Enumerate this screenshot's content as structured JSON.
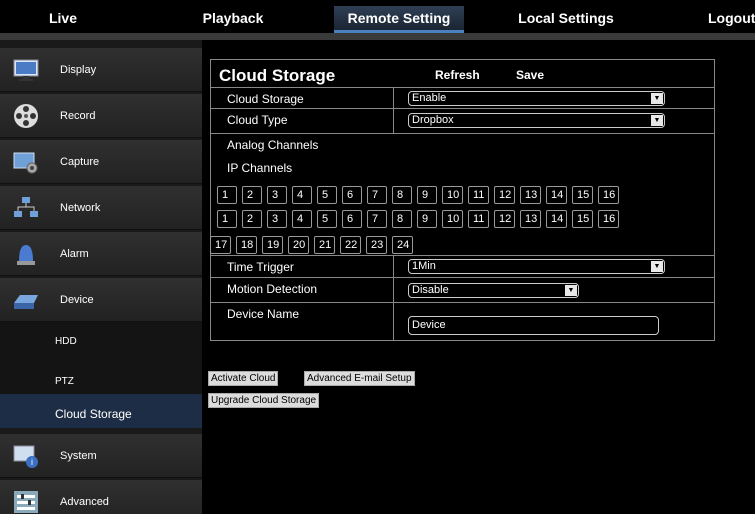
{
  "topnav": {
    "tabs": [
      {
        "label": "Live"
      },
      {
        "label": "Playback"
      },
      {
        "label": "Remote Setting"
      },
      {
        "label": "Local Settings"
      },
      {
        "label": "Logout"
      }
    ],
    "active_tab": "Remote Setting"
  },
  "sidebar": {
    "items": [
      {
        "label": "Display",
        "icon": "monitor-icon"
      },
      {
        "label": "Record",
        "icon": "film-reel-icon"
      },
      {
        "label": "Capture",
        "icon": "capture-icon"
      },
      {
        "label": "Network",
        "icon": "network-icon"
      },
      {
        "label": "Alarm",
        "icon": "alarm-light-icon"
      },
      {
        "label": "Device",
        "icon": "hard-drive-icon"
      }
    ],
    "sub_items": [
      {
        "label": "HDD"
      },
      {
        "label": "PTZ"
      },
      {
        "label": "Cloud Storage"
      }
    ],
    "bottom_items": [
      {
        "label": "System",
        "icon": "system-info-icon"
      },
      {
        "label": "Advanced",
        "icon": "advanced-settings-icon"
      }
    ]
  },
  "panel": {
    "title": "Cloud Storage",
    "refresh_label": "Refresh",
    "save_label": "Save",
    "cloud_storage": {
      "label": "Cloud Storage",
      "value": "Enable"
    },
    "cloud_type": {
      "label": "Cloud Type",
      "value": "Dropbox"
    },
    "analog_channels_label": "Analog Channels",
    "ip_channels_label": "IP Channels",
    "channel_row_a": [
      "1",
      "2",
      "3",
      "4",
      "5",
      "6",
      "7",
      "8",
      "9",
      "10",
      "11",
      "12",
      "13",
      "14",
      "15",
      "16"
    ],
    "channel_row_b": [
      "1",
      "2",
      "3",
      "4",
      "5",
      "6",
      "7",
      "8",
      "9",
      "10",
      "11",
      "12",
      "13",
      "14",
      "15",
      "16"
    ],
    "channel_row_c": [
      "17",
      "18",
      "19",
      "20",
      "21",
      "22",
      "23",
      "24"
    ],
    "time_trigger": {
      "label": "Time Trigger",
      "value": "1Min"
    },
    "motion_detection": {
      "label": "Motion Detection",
      "value": "Disable"
    },
    "device_name": {
      "label": "Device Name",
      "value": "Device"
    }
  },
  "actions": {
    "activate_cloud": "Activate Cloud",
    "advanced_email": "Advanced E-mail Setup",
    "upgrade_cloud": "Upgrade Cloud Storage"
  },
  "colors": {
    "background": "#000000",
    "sidebar_item": "#2a2a2a",
    "active_sub": "#1d2d45",
    "border": "#888888"
  }
}
